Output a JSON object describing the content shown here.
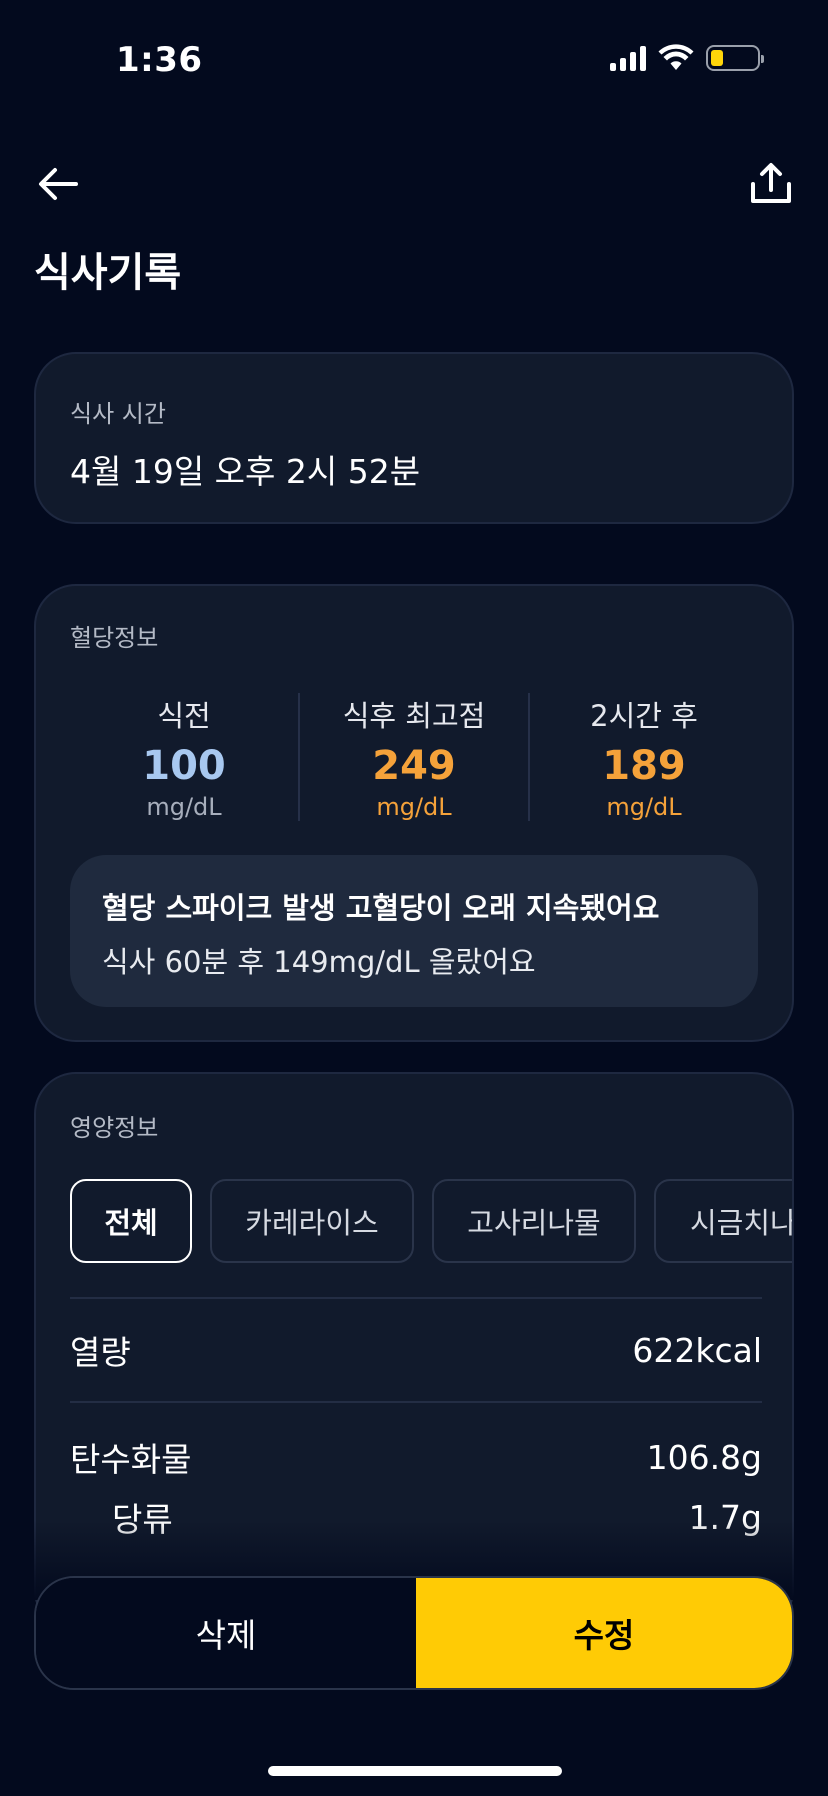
{
  "status_bar": {
    "time": "1:36",
    "icons": [
      "signal-icon",
      "wifi-icon",
      "battery-icon"
    ],
    "battery_color": "#FFD60A"
  },
  "nav": {
    "back_icon": "arrow-left-icon",
    "share_icon": "share-icon",
    "title": "식사기록"
  },
  "meal": {
    "label": "식사 시간",
    "time": "4월 19일 오후 2시 52분"
  },
  "glucose": {
    "label": "혈당정보",
    "metrics": [
      {
        "label": "식전",
        "value": "100",
        "unit": "mg/dL",
        "color": "#A8C8F0"
      },
      {
        "label": "식후 최고점",
        "value": "249",
        "unit": "mg/dL",
        "color": "#F5A23A"
      },
      {
        "label": "2시간 후",
        "value": "189",
        "unit": "mg/dL",
        "color": "#F5A23A"
      }
    ],
    "alert": {
      "title": "혈당 스파이크 발생 고혈당이 오래 지속됐어요",
      "body": "식사 60분 후 149mg/dL 올랐어요"
    }
  },
  "nutrition": {
    "label": "영양정보",
    "tabs": [
      {
        "label": "전체",
        "active": true
      },
      {
        "label": "카레라이스",
        "active": false
      },
      {
        "label": "고사리나물",
        "active": false
      },
      {
        "label": "시금치나",
        "active": false
      }
    ],
    "rows": [
      {
        "label": "열량",
        "value": "622kcal"
      },
      {
        "label": "탄수화물",
        "value": "106.8g"
      },
      {
        "label": "당류",
        "value": "1.7g"
      }
    ]
  },
  "actions": {
    "delete_label": "삭제",
    "edit_label": "수정",
    "edit_color": "#FFCB05"
  }
}
